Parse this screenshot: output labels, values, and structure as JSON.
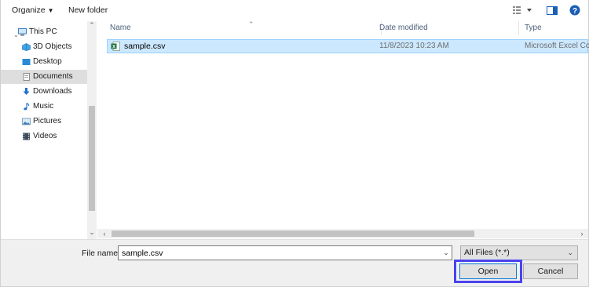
{
  "toolbar": {
    "organize_label": "Organize",
    "new_folder_label": "New folder"
  },
  "nav": {
    "items": [
      {
        "label": "This PC",
        "icon": "this-pc-icon"
      },
      {
        "label": "3D Objects",
        "icon": "3d-objects-icon"
      },
      {
        "label": "Desktop",
        "icon": "desktop-icon"
      },
      {
        "label": "Documents",
        "icon": "documents-icon",
        "selected": true
      },
      {
        "label": "Downloads",
        "icon": "downloads-icon"
      },
      {
        "label": "Music",
        "icon": "music-icon"
      },
      {
        "label": "Pictures",
        "icon": "pictures-icon"
      },
      {
        "label": "Videos",
        "icon": "videos-icon"
      }
    ]
  },
  "columns": {
    "name": "Name",
    "date": "Date modified",
    "type": "Type"
  },
  "files": [
    {
      "name": "sample.csv",
      "date": "11/8/2023 10:23 AM",
      "type": "Microsoft Excel Co",
      "selected": true
    }
  ],
  "bottom": {
    "file_name_label": "File name:",
    "file_name_value": "sample.csv",
    "file_type_value": "All Files (*.*)",
    "open_label": "Open",
    "cancel_label": "Cancel"
  },
  "colors": {
    "selection_bg": "#cce8ff",
    "selection_border": "#99d1ff",
    "focus_highlight": "#4a43f0",
    "help_icon": "#1a5fb4"
  }
}
